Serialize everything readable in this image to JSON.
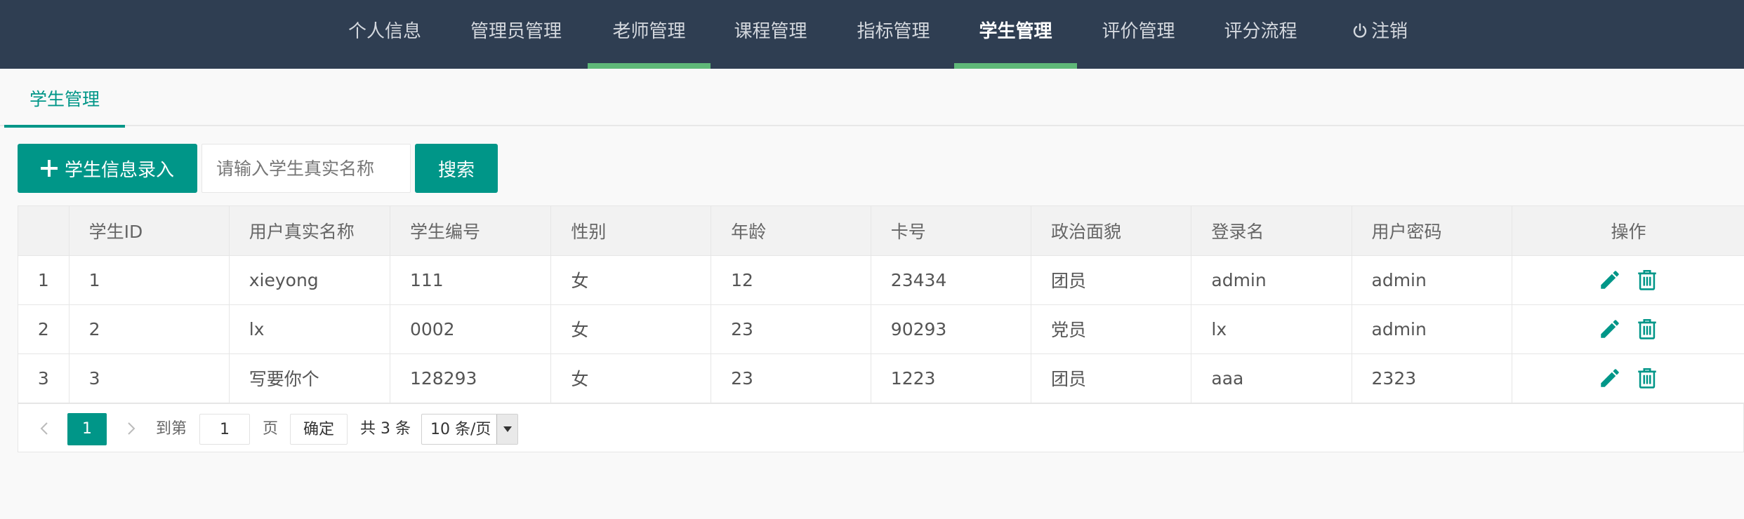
{
  "nav": {
    "items": [
      {
        "label": "个人信息"
      },
      {
        "label": "管理员管理"
      },
      {
        "label": "老师管理"
      },
      {
        "label": "课程管理"
      },
      {
        "label": "指标管理"
      },
      {
        "label": "学生管理"
      },
      {
        "label": "评价管理"
      },
      {
        "label": "评分流程"
      },
      {
        "label": "注销",
        "icon": "power-icon"
      }
    ],
    "active": "学生管理"
  },
  "tab": {
    "label": "学生管理"
  },
  "toolbar": {
    "add_label": "学生信息录入",
    "search_placeholder": "请输入学生真实名称",
    "search_label": "搜索"
  },
  "table": {
    "headers": [
      "",
      "学生ID",
      "用户真实名称",
      "学生编号",
      "性别",
      "年龄",
      "卡号",
      "政治面貌",
      "登录名",
      "用户密码",
      "操作"
    ],
    "rows": [
      [
        "1",
        "1",
        "xieyong",
        "111",
        "女",
        "12",
        "23434",
        "团员",
        "admin",
        "admin"
      ],
      [
        "2",
        "2",
        "lx",
        "0002",
        "女",
        "23",
        "90293",
        "党员",
        "lx",
        "admin"
      ],
      [
        "3",
        "3",
        "写要你个",
        "128293",
        "女",
        "23",
        "1223",
        "团员",
        "aaa",
        "2323"
      ]
    ],
    "row_actions": [
      "edit-icon",
      "trash-icon"
    ]
  },
  "pagination": {
    "current": "1",
    "goto_prefix": "到第",
    "goto_value": "1",
    "goto_suffix": "页",
    "confirm": "确定",
    "total": "共 3 条",
    "page_size": "10 条/页"
  },
  "colors": {
    "nav_bg": "#2f3e52",
    "accent": "#009688",
    "nav_underline": "#5fb878"
  }
}
